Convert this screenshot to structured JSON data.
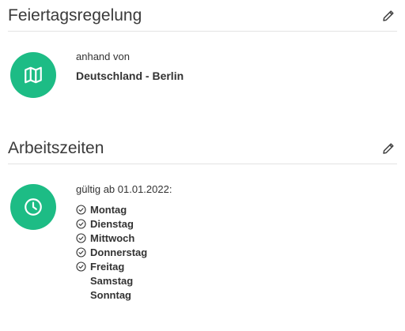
{
  "holidays": {
    "title": "Feiertagsregelung",
    "caption": "anhand von",
    "value": "Deutschland - Berlin",
    "icon": "map-icon",
    "edit_icon": "pencil-icon"
  },
  "working_times": {
    "title": "Arbeitszeiten",
    "valid_from": "gültig ab 01.01.2022:",
    "icon": "clock-icon",
    "edit_icon": "pencil-icon",
    "days": [
      {
        "label": "Montag",
        "active": true
      },
      {
        "label": "Dienstag",
        "active": true
      },
      {
        "label": "Mittwoch",
        "active": true
      },
      {
        "label": "Donnerstag",
        "active": true
      },
      {
        "label": "Freitag",
        "active": true
      },
      {
        "label": "Samstag",
        "active": false
      },
      {
        "label": "Sonntag",
        "active": false
      }
    ]
  },
  "colors": {
    "accent": "#1dbc85",
    "divider": "#e3e3e3"
  }
}
